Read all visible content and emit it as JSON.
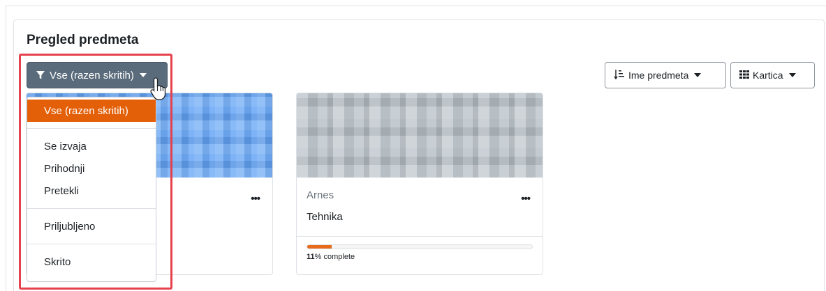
{
  "block": {
    "title": "Pregled predmeta"
  },
  "filter": {
    "label": "Vse (razen skritih)",
    "icon": "filter-icon",
    "options": [
      {
        "label": "Vse (razen skritih)",
        "active": true
      },
      {
        "label": "Se izvaja"
      },
      {
        "label": "Prihodnji"
      },
      {
        "label": "Pretekli"
      },
      {
        "label": "Priljubljeno"
      },
      {
        "label": "Skrito"
      }
    ]
  },
  "sort": {
    "label": "Ime predmeta",
    "icon": "sort-icon"
  },
  "view": {
    "label": "Kartica",
    "icon": "grid-icon"
  },
  "cards": [
    {
      "category": "",
      "name": "",
      "menu": "•••"
    },
    {
      "category": "Arnes",
      "name": "Tehnika",
      "menu": "•••",
      "progress_value": "11",
      "progress_suffix": "% complete",
      "progress_percent": 11
    }
  ],
  "colors": {
    "accent": "#e35f08",
    "button_dark": "#5a6b7b",
    "highlight": "#e5424d"
  }
}
